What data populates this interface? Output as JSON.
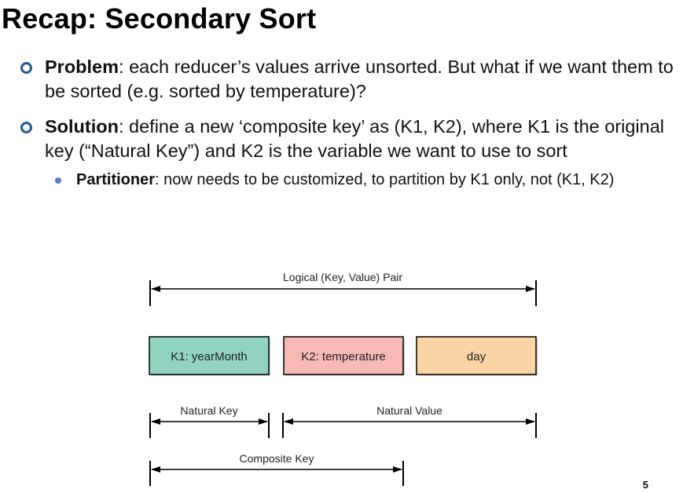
{
  "slide": {
    "title": "Recap: Secondary Sort",
    "page_number": "5"
  },
  "bullets": [
    {
      "term": "Problem",
      "text": ": each reducer’s values arrive unsorted. But what if we want them to be sorted (e.g. sorted by temperature)?"
    },
    {
      "term": "Solution",
      "text": ": define a new ‘composite key’ as (K1, K2), where K1 is the original key (“Natural Key”) and K2 is the variable we want to use to sort",
      "sub": {
        "term": "Partitioner",
        "text": ": now needs to be customized, to partition by K1 only, not (K1, K2)"
      }
    }
  ],
  "diagram": {
    "logical_pair_label": "Logical (Key, Value) Pair",
    "boxes": [
      {
        "label": "K1: yearMonth",
        "color": "#8fd3c0"
      },
      {
        "label": "K2: temperature",
        "color": "#f7b8b6"
      },
      {
        "label": "day",
        "color": "#fbd4a4"
      }
    ],
    "natural_key_label": "Natural Key",
    "natural_value_label": "Natural Value",
    "composite_key_label": "Composite Key"
  },
  "colors": {
    "bullet_ring": "#1f5c93",
    "sub_bullet_dot": "#5b7cc6"
  }
}
